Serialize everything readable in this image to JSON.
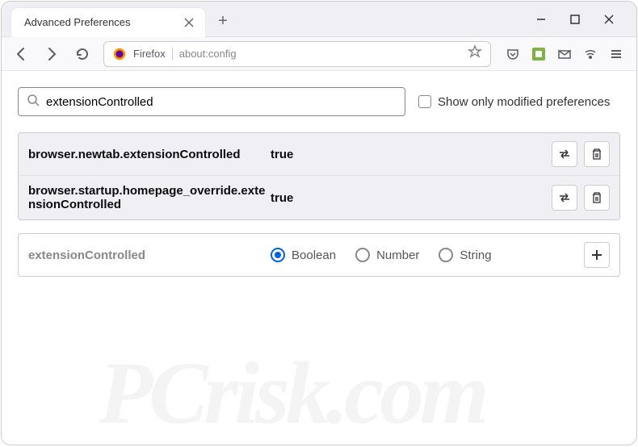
{
  "tab": {
    "title": "Advanced Preferences"
  },
  "urlbar": {
    "brand": "Firefox",
    "url": "about:config"
  },
  "search": {
    "value": "extensionControlled"
  },
  "checkbox": {
    "label": "Show only modified preferences"
  },
  "prefs": [
    {
      "name": "browser.newtab.extensionControlled",
      "value": "true"
    },
    {
      "name": "browser.startup.homepage_override.extensionControlled",
      "value": "true"
    }
  ],
  "newpref": {
    "name": "extensionControlled",
    "types": [
      "Boolean",
      "Number",
      "String"
    ],
    "selected": "Boolean"
  },
  "watermark": "PCrisk.com"
}
